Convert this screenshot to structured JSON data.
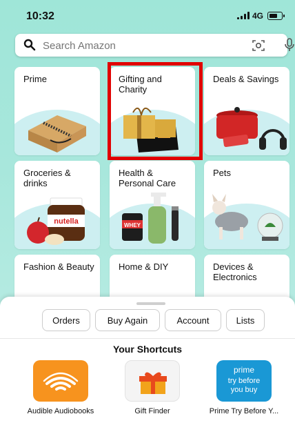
{
  "status_bar": {
    "time": "10:32",
    "network": "4G"
  },
  "search": {
    "placeholder": "Search Amazon"
  },
  "categories": [
    {
      "label": "Prime"
    },
    {
      "label": "Gifting and Charity"
    },
    {
      "label": "Deals & Savings"
    },
    {
      "label": "Groceries & drinks"
    },
    {
      "label": "Health & Personal Care"
    },
    {
      "label": "Pets"
    },
    {
      "label": "Fashion & Beauty"
    },
    {
      "label": "Home & DIY"
    },
    {
      "label": "Devices & Electronics"
    }
  ],
  "product_text": {
    "nutella": "nutella",
    "whey": "WHEY"
  },
  "quick_links": [
    "Orders",
    "Buy Again",
    "Account",
    "Lists"
  ],
  "shortcuts": {
    "title": "Your Shortcuts",
    "items": [
      {
        "label": "Audible Audiobooks",
        "icon": "audible-icon"
      },
      {
        "label": "Gift Finder",
        "icon": "gift-icon"
      },
      {
        "label": "Prime Try Before Y...",
        "icon": "prime-try-icon",
        "icon_text": [
          "prime",
          "try before",
          "you buy"
        ]
      }
    ]
  },
  "colors": {
    "background": "#a8e7dc",
    "highlight": "#e10000",
    "audible": "#f7931e",
    "prime_blue": "#1a98d5"
  }
}
